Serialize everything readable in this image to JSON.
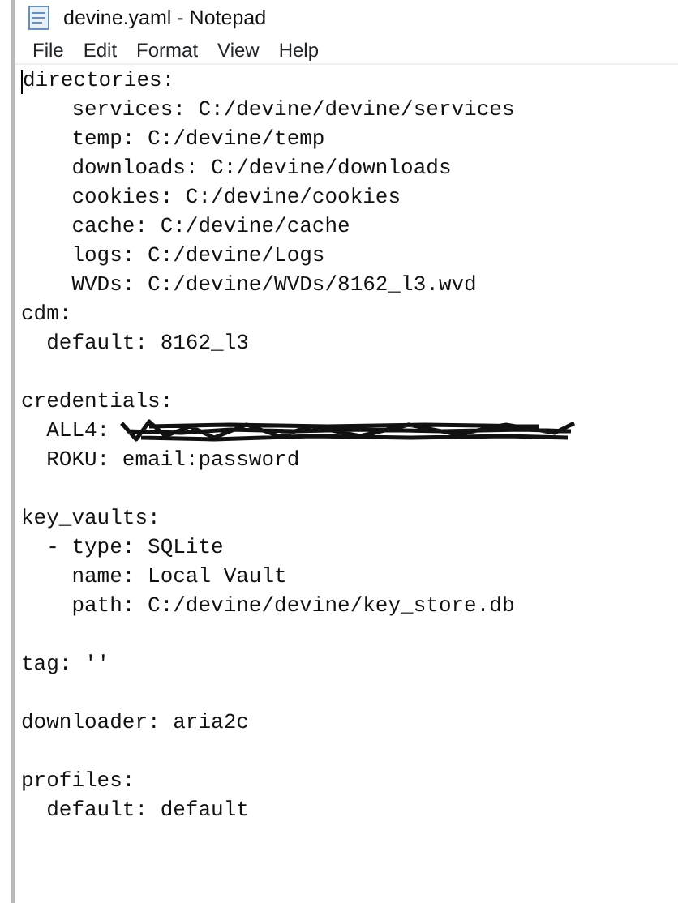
{
  "window": {
    "title": "devine.yaml - Notepad"
  },
  "menu": [
    "File",
    "Edit",
    "Format",
    "View",
    "Help"
  ],
  "lines": [
    {
      "text": "directories:"
    },
    {
      "text": "    services: C:/devine/devine/services"
    },
    {
      "text": "    temp: C:/devine/temp"
    },
    {
      "text": "    downloads: C:/devine/downloads"
    },
    {
      "text": "    cookies: C:/devine/cookies"
    },
    {
      "text": "    cache: C:/devine/cache"
    },
    {
      "text": "    logs: C:/devine/Logs"
    },
    {
      "text": "    WVDs: C:/devine/WVDs/8162_l3.wvd"
    },
    {
      "text": "cdm:"
    },
    {
      "text": "  default: 8162_l3"
    },
    {
      "text": "credentials:",
      "blank_line_before": true
    },
    {
      "text": "  ALL4:",
      "redacted": true
    },
    {
      "text": "  ROKU: email:password"
    },
    {
      "text": "key_vaults:",
      "blank_line_before": true
    },
    {
      "text": "  - type: SQLite"
    },
    {
      "text": "    name: Local Vault"
    },
    {
      "text": "    path: C:/devine/devine/key_store.db"
    },
    {
      "text": "tag: ''",
      "blank_line_before": true
    },
    {
      "text": "downloader: aria2c",
      "blank_line_before": true
    },
    {
      "text": "profiles:",
      "blank_line_before": true
    },
    {
      "text": "  default: default"
    }
  ]
}
